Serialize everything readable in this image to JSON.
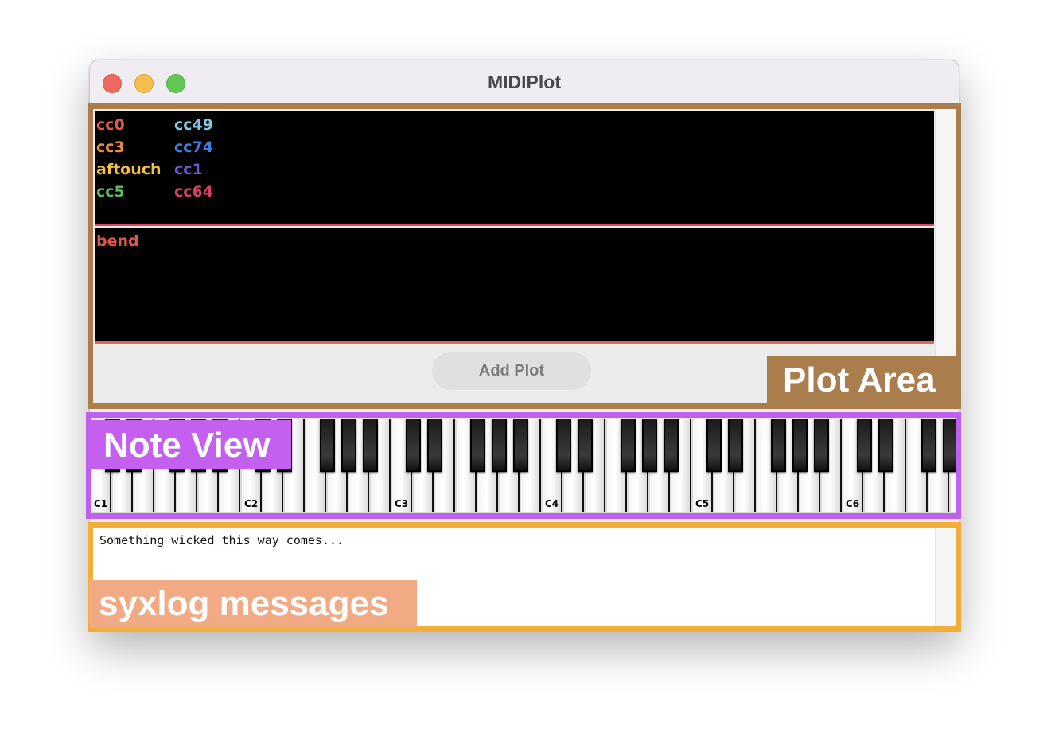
{
  "window": {
    "title": "MIDIPlot"
  },
  "plot_area": {
    "plots": [
      {
        "legend": [
          {
            "label": "cc0",
            "color": "#e05a4c"
          },
          {
            "label": "cc3",
            "color": "#f08c3c"
          },
          {
            "label": "aftouch",
            "color": "#f3c142"
          },
          {
            "label": "cc5",
            "color": "#5cb85c"
          },
          {
            "label": "cc49",
            "color": "#7ec8e3"
          },
          {
            "label": "cc74",
            "color": "#3d7fe0"
          },
          {
            "label": "cc1",
            "color": "#6a5acd"
          },
          {
            "label": "cc64",
            "color": "#d94060"
          }
        ],
        "line_color": "#d9485e"
      },
      {
        "legend": [
          {
            "label": "bend",
            "color": "#e0574a"
          }
        ],
        "line_color": "#e0675a"
      }
    ],
    "add_button": "Add Plot"
  },
  "note_view": {
    "octave_labels": [
      "C1",
      "C2",
      "C3",
      "C4",
      "C5",
      "C6"
    ]
  },
  "syxlog": {
    "message": "Something wicked this way comes..."
  },
  "annotations": {
    "plot_area": "Plot Area",
    "note_view": "Note View",
    "syxlog": "syxlog messages"
  }
}
